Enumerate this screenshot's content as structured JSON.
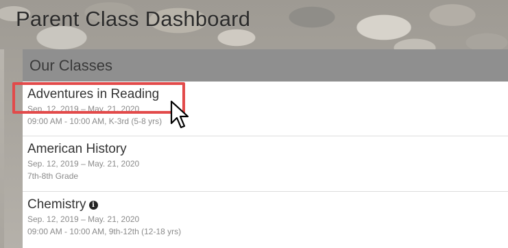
{
  "page": {
    "title": "Parent Class Dashboard"
  },
  "panel": {
    "header": "Our Classes"
  },
  "classes": [
    {
      "name": "Adventures in Reading",
      "dates": "Sep. 12, 2019 – May. 21, 2020",
      "details": "09:00 AM - 10:00 AM, K-3rd (5-8 yrs)",
      "highlighted": true,
      "has_info_icon": false
    },
    {
      "name": "American History",
      "dates": "Sep. 12, 2019 – May. 21, 2020",
      "details": "7th-8th Grade",
      "highlighted": false,
      "has_info_icon": false
    },
    {
      "name": "Chemistry",
      "dates": "Sep. 12, 2019 – May. 21, 2020",
      "details": "09:00 AM - 10:00 AM, 9th-12th (12-18 yrs)",
      "highlighted": false,
      "has_info_icon": true
    }
  ],
  "icons": {
    "info": "info-circle-icon",
    "cursor": "mouse-pointer-icon"
  },
  "colors": {
    "highlight": "#e24a4a",
    "header_bg": "#8f8f8f"
  }
}
